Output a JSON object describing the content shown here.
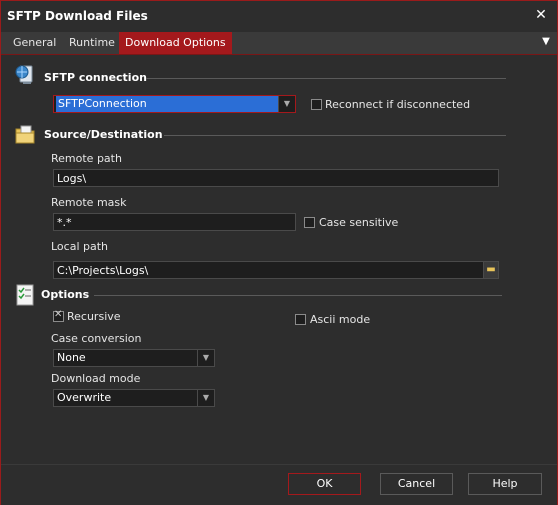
{
  "window": {
    "title": "SFTP Download Files",
    "close_glyph": "✕"
  },
  "tabs": [
    {
      "label": "General",
      "active": false
    },
    {
      "label": "Runtime",
      "active": false
    },
    {
      "label": "Download Options",
      "active": true
    }
  ],
  "tab_menu_glyph": "▼",
  "sftp_connection": {
    "section_title": "SFTP connection",
    "connection_value": "SFTPConnection",
    "reconnect_label": "Reconnect if disconnected",
    "reconnect_checked": false
  },
  "source_destination": {
    "section_title": "Source/Destination",
    "remote_path_label": "Remote path",
    "remote_path_value": "Logs\\",
    "remote_mask_label": "Remote mask",
    "remote_mask_value": "*.*",
    "case_sensitive_label": "Case sensitive",
    "case_sensitive_checked": false,
    "local_path_label": "Local path",
    "local_path_value": "C:\\Projects\\Logs\\"
  },
  "options": {
    "section_title": "Options",
    "recursive_label": "Recursive",
    "recursive_checked": true,
    "ascii_mode_label": "Ascii mode",
    "ascii_mode_checked": false,
    "case_conversion_label": "Case conversion",
    "case_conversion_value": "None",
    "download_mode_label": "Download mode",
    "download_mode_value": "Overwrite"
  },
  "footer": {
    "ok_label": "OK",
    "cancel_label": "Cancel",
    "help_label": "Help"
  },
  "colors": {
    "accent": "#a4191c",
    "selection": "#2b6ed6",
    "background": "#2d2d2d"
  }
}
